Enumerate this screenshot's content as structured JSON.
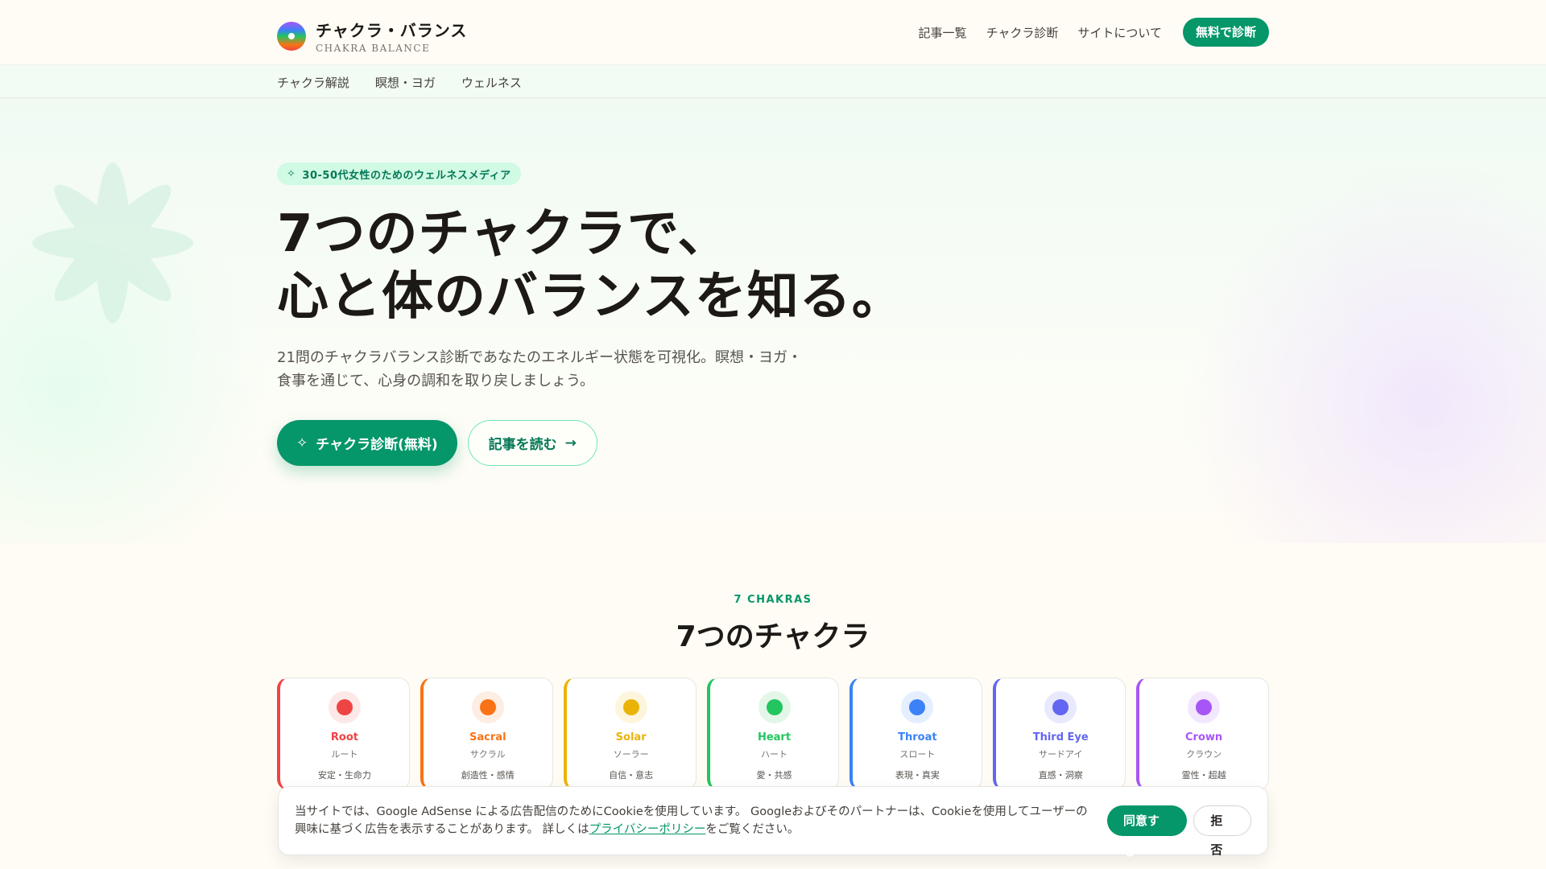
{
  "brand": {
    "title": "チャクラ・バランス",
    "subtitle": "CHAKRA BALANCE"
  },
  "topnav": {
    "items": [
      "記事一覧",
      "チャクラ診断",
      "サイトについて"
    ],
    "cta": "無料で診断"
  },
  "subnav": [
    "チャクラ解説",
    "瞑想・ヨガ",
    "ウェルネス"
  ],
  "hero": {
    "badge": "30-50代女性のためのウェルネスメディア",
    "headline_line1": "7つのチャクラで、",
    "headline_line2": "心と体のバランスを知る。",
    "lead_line1": "21問のチャクラバランス診断であなたのエネルギー状態を可視化。瞑想・ヨガ・",
    "lead_line2": "食事を通じて、心身の調和を取り戻しましょう。",
    "primary_button": "チャクラ診断(無料)",
    "secondary_button": "記事を読む"
  },
  "section": {
    "label": "7 CHAKRAS",
    "title": "7つのチャクラ"
  },
  "chakras": [
    {
      "name": "Root",
      "kana": "ルート",
      "desc": "安定・生命力",
      "color": "#ef4444",
      "bg": "#fde8e8"
    },
    {
      "name": "Sacral",
      "kana": "サクラル",
      "desc": "創造性・感情",
      "color": "#f97316",
      "bg": "#feede2"
    },
    {
      "name": "Solar",
      "kana": "ソーラー",
      "desc": "自信・意志",
      "color": "#eab308",
      "bg": "#fdf6dc"
    },
    {
      "name": "Heart",
      "kana": "ハート",
      "desc": "愛・共感",
      "color": "#22c55e",
      "bg": "#e3f7e9"
    },
    {
      "name": "Throat",
      "kana": "スロート",
      "desc": "表現・真実",
      "color": "#3b82f6",
      "bg": "#e4eefe"
    },
    {
      "name": "Third Eye",
      "kana": "サードアイ",
      "desc": "直感・洞察",
      "color": "#6366f1",
      "bg": "#e9e9fd"
    },
    {
      "name": "Crown",
      "kana": "クラウン",
      "desc": "霊性・超越",
      "color": "#a855f7",
      "bg": "#f3e7fe"
    }
  ],
  "cookie": {
    "text_before": "当サイトでは、Google AdSense による広告配信のためにCookieを使用しています。 Googleおよびそのパートナーは、Cookieを使用してユーザーの興味に基づく広告を表示することがあります。 詳しくは",
    "link": "プライバシーポリシー",
    "text_after": "をご覧ください。",
    "agree": "同意する",
    "reject": "拒否"
  }
}
